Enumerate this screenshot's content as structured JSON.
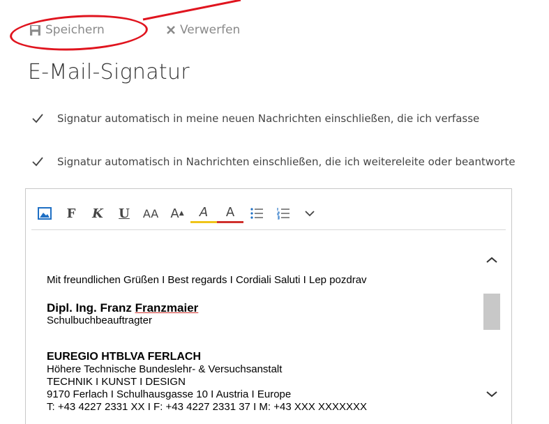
{
  "toolbar": {
    "save_label": "Speichern",
    "discard_label": "Verwerfen"
  },
  "page_title": "E-Mail-Signatur",
  "options": [
    {
      "label": "Signatur automatisch in meine neuen Nachrichten einschließen, die ich verfasse",
      "checked": true
    },
    {
      "label": "Signatur automatisch in Nachrichten einschließen, die ich weitereleite oder beantworte",
      "checked": true
    }
  ],
  "formatting": {
    "bold": "F",
    "italic": "K",
    "underline": "U",
    "font_size": "AA",
    "grow_font": "A",
    "highlight": "A",
    "font_color": "A",
    "highlight_color": "#f0c419",
    "font_color_value": "#d0312d",
    "icons": [
      "picture-icon",
      "bold-icon",
      "italic-icon",
      "underline-icon",
      "font-size-icon",
      "grow-font-icon",
      "highlight-icon",
      "font-color-icon",
      "bullets-icon",
      "numbering-icon",
      "chevron-down-icon"
    ]
  },
  "signature": {
    "greeting": "Mit freundlichen Grüßen I Best regards I Cordiali Saluti I Lep pozdrav",
    "name_prefix": "Dipl. Ing. Franz ",
    "name_last": "Franzmaier",
    "role": "Schulbuchbeauftragter",
    "org": "EUREGIO HTBLVA FERLACH",
    "org_sub": "Höhere Technische Bundeslehr- & Versuchsanstalt",
    "tagline": "TECHNIK I KUNST I DESIGN",
    "address": "9170 Ferlach I Schulhausgasse 10 I Austria I Europe",
    "contact_partial": "T: +43 4227 2331 XX I F: +43 4227 2331 37 I M: +43 XXX XXXXXXX"
  },
  "colors": {
    "annotation": "#e0141e",
    "muted": "#8a8a8a"
  }
}
